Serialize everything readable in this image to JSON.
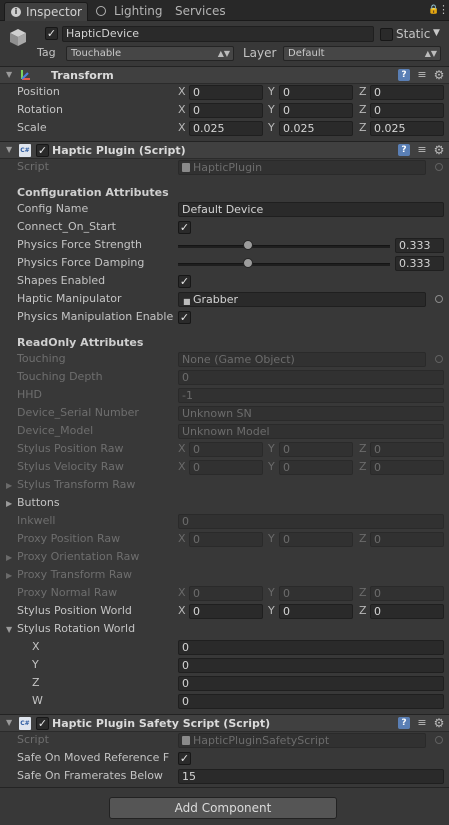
{
  "tabs": {
    "inspector": "Inspector",
    "lighting": "Lighting",
    "services": "Services"
  },
  "object": {
    "name": "HapticDevice",
    "static_label": "Static",
    "tag_label": "Tag",
    "tag_value": "Touchable",
    "layer_label": "Layer",
    "layer_value": "Default"
  },
  "transform": {
    "title": "Transform",
    "position_label": "Position",
    "rotation_label": "Rotation",
    "scale_label": "Scale",
    "position": {
      "x": "0",
      "y": "0",
      "z": "0"
    },
    "rotation": {
      "x": "0",
      "y": "0",
      "z": "0"
    },
    "scale": {
      "x": "0.025",
      "y": "0.025",
      "z": "0.025"
    }
  },
  "axes": {
    "x": "X",
    "y": "Y",
    "z": "Z",
    "w": "W"
  },
  "haptic": {
    "title": "Haptic Plugin (Script)",
    "script_label": "Script",
    "script_value": "HapticPlugin",
    "config_header": "Configuration Attributes",
    "config_name_label": "Config Name",
    "config_name_value": "Default Device",
    "connect_label": "Connect_On_Start",
    "connect_checked": true,
    "force_strength_label": "Physics Force Strength",
    "force_strength_value": "0.333",
    "force_damping_label": "Physics Force Damping",
    "force_damping_value": "0.333",
    "shapes_label": "Shapes Enabled",
    "shapes_checked": true,
    "manipulator_label": "Haptic Manipulator",
    "manipulator_value": "Grabber",
    "physics_manip_label": "Physics Manipulation Enable",
    "physics_manip_checked": true,
    "readonly_header": "ReadOnly Attributes",
    "touching_label": "Touching",
    "touching_value": "None (Game Object)",
    "touching_depth_label": "Touching Depth",
    "touching_depth_value": "0",
    "hhd_label": "HHD",
    "hhd_value": "-1",
    "serial_label": "Device_Serial Number",
    "serial_value": "Unknown SN",
    "model_label": "Device_Model",
    "model_value": "Unknown Model",
    "stylus_pos_raw_label": "Stylus Position Raw",
    "stylus_pos_raw": {
      "x": "0",
      "y": "0",
      "z": "0"
    },
    "stylus_vel_raw_label": "Stylus Velocity Raw",
    "stylus_vel_raw": {
      "x": "0",
      "y": "0",
      "z": "0"
    },
    "stylus_transform_raw_label": "Stylus Transform Raw",
    "buttons_label": "Buttons",
    "inkwell_label": "Inkwell",
    "inkwell_value": "0",
    "proxy_pos_raw_label": "Proxy Position Raw",
    "proxy_pos_raw": {
      "x": "0",
      "y": "0",
      "z": "0"
    },
    "proxy_orient_raw_label": "Proxy Orientation Raw",
    "proxy_transform_raw_label": "Proxy Transform Raw",
    "proxy_normal_raw_label": "Proxy Normal Raw",
    "proxy_normal_raw": {
      "x": "0",
      "y": "0",
      "z": "0"
    },
    "stylus_pos_world_label": "Stylus Position World",
    "stylus_pos_world": {
      "x": "0",
      "y": "0",
      "z": "0"
    },
    "stylus_rot_world_label": "Stylus Rotation World",
    "stylus_rot_world": {
      "x": "0",
      "y": "0",
      "z": "0",
      "w": "0"
    }
  },
  "safety": {
    "title": "Haptic Plugin Safety Script (Script)",
    "script_label": "Script",
    "script_value": "HapticPluginSafetyScript",
    "safe_moved_label": "Safe On Moved Reference F",
    "safe_moved_checked": true,
    "safe_framerates_label": "Safe On Framerates Below",
    "safe_framerates_value": "15"
  },
  "add_component": "Add Component",
  "colors": {
    "background": "#383838",
    "header": "#404040",
    "field": "#2a2a2a",
    "text": "#c4c4c4",
    "disabled_text": "#6e6e6e"
  }
}
